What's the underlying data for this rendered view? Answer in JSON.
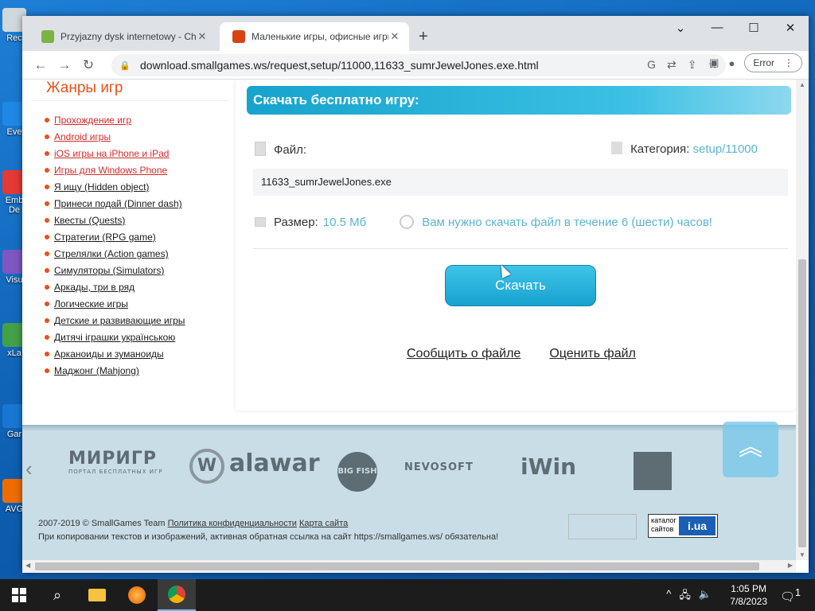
{
  "desktop": {
    "icons": [
      {
        "label": "Rec",
        "color": "#cfd8dc"
      },
      {
        "label": "Eve",
        "color": "#1e88e5"
      },
      {
        "label": "Emb De",
        "color": "#e53935"
      },
      {
        "label": "Visu",
        "color": "#7e57c2"
      },
      {
        "label": "xLa",
        "color": "#43a047"
      },
      {
        "label": "Gar",
        "color": "#1976d2"
      },
      {
        "label": "AVG",
        "color": "#ef6c00"
      }
    ]
  },
  "browser": {
    "tabs": [
      {
        "title": "Przyjazny dysk internetowy - Cho",
        "favicon_color": "#7cb342"
      },
      {
        "title": "Маленькие игры, офисные игры",
        "favicon_color": "#d84315"
      }
    ],
    "new_tab": "+",
    "window_controls": {
      "chevron": "⌄",
      "minimize": "—",
      "maximize": "☐",
      "close": "✕"
    },
    "nav": {
      "back": "←",
      "forward": "→",
      "reload": "↻"
    },
    "url": "download.smallgames.ws/request,setup/11000,11633_sumrJewelJones.exe.html",
    "omnibox_icons": [
      "G",
      "⇄",
      "⇪",
      "☆"
    ],
    "profile_error": "Error",
    "menu": "⋮"
  },
  "sidebar": {
    "heading": "Жанры игр",
    "categories": [
      {
        "label": "Прохождение игр",
        "red": true
      },
      {
        "label": "Android игры",
        "red": true
      },
      {
        "label": "iOS игры на iPhone и iPad",
        "red": true
      },
      {
        "label": "Игры для Windows Phone",
        "red": true
      },
      {
        "label": "Я ищу (Hidden object)",
        "red": false
      },
      {
        "label": "Принеси подай (Dinner dash)",
        "red": false
      },
      {
        "label": "Квесты (Quests)",
        "red": false
      },
      {
        "label": "Стратегии (RPG game)",
        "red": false
      },
      {
        "label": "Стрелялки (Action games)",
        "red": false
      },
      {
        "label": "Симуляторы (Simulators)",
        "red": false
      },
      {
        "label": "Аркады, три в ряд",
        "red": false
      },
      {
        "label": "Логические игры",
        "red": false
      },
      {
        "label": "Детские и развивающие игры",
        "red": false
      },
      {
        "label": "Дитячі іграшки українською",
        "red": false
      },
      {
        "label": "Арканоиды и зуманоиды",
        "red": false
      },
      {
        "label": "Маджонг (Mahjong)",
        "red": false
      }
    ]
  },
  "download": {
    "header": "Скачать бесплатно игру:",
    "file_label": "Файл:",
    "category_label": "Категория:",
    "category_value": "setup/11000",
    "filename": "11633_sumrJewelJones.exe",
    "size_label": "Размер:",
    "size_value": "10.5 Мб",
    "warning": "Вам нужно скачать файл в течение 6 (шести) часов!",
    "button": "Скачать",
    "report_link": "Сообщить о файле",
    "rate_link": "Оценить файл"
  },
  "partners": {
    "arrow": "‹",
    "logos": [
      "МИРИГР",
      "ПОРТАЛ БЕСПЛАТНЫХ ИГР",
      "alawar",
      "BIG FISH",
      "NEVOSOFT",
      "iWin"
    ],
    "scroll_top": "︽"
  },
  "footer": {
    "copyright": "2007-2019 © SmallGames Team",
    "privacy": "Политика конфиденциальности",
    "sitemap": "Карта сайта",
    "copy_notice": "При копировании текстов и изображений, активная обратная ссылка на сайт https://smallgames.ws/ обязательна!",
    "catalog_label": "каталог сайтов",
    "catalog_ua": "i.ua"
  },
  "taskbar": {
    "time": "1:05 PM",
    "date": "7/8/2023",
    "notifications": "1"
  }
}
